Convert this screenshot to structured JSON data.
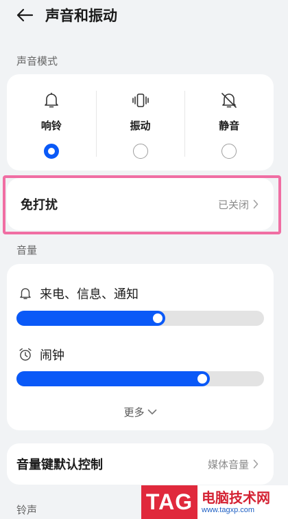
{
  "header": {
    "title": "声音和振动"
  },
  "sound_mode": {
    "section_label": "声音模式",
    "options": [
      {
        "label": "响铃",
        "icon": "bell-icon",
        "selected": true
      },
      {
        "label": "振动",
        "icon": "vibrate-icon",
        "selected": false
      },
      {
        "label": "静音",
        "icon": "bell-off-icon",
        "selected": false
      }
    ]
  },
  "dnd": {
    "title": "免打扰",
    "status": "已关闭"
  },
  "volume": {
    "section_label": "音量",
    "items": [
      {
        "label": "来电、信息、通知",
        "icon": "bell-icon",
        "level": 0.6
      },
      {
        "label": "闹钟",
        "icon": "alarm-clock-icon",
        "level": 0.78
      }
    ],
    "more_label": "更多"
  },
  "volume_keys": {
    "title": "音量键默认控制",
    "value": "媒体音量"
  },
  "ringtone": {
    "section_label": "铃声"
  },
  "watermark": {
    "tag": "TAG",
    "site": "电脑技术网",
    "url": "www.tagxp.com"
  },
  "colors": {
    "accent": "#0a59f7",
    "highlight": "#f06ea3",
    "background": "#f1f3f5"
  }
}
